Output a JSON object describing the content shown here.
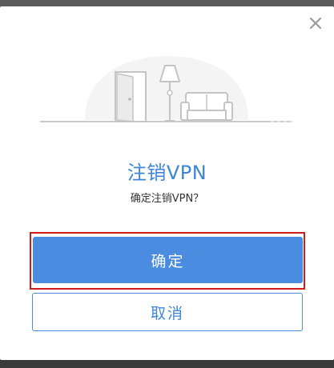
{
  "dialog": {
    "title": "注销VPN",
    "message": "确定注销VPN？",
    "confirm_label": "确定",
    "cancel_label": "取消"
  },
  "icons": {
    "close": "close-icon",
    "illustration": "empty-room-illustration"
  },
  "colors": {
    "accent": "#4a8de0",
    "title": "#3d86d8",
    "highlight": "#d11a1a",
    "overlay": "#5b5b5b"
  }
}
